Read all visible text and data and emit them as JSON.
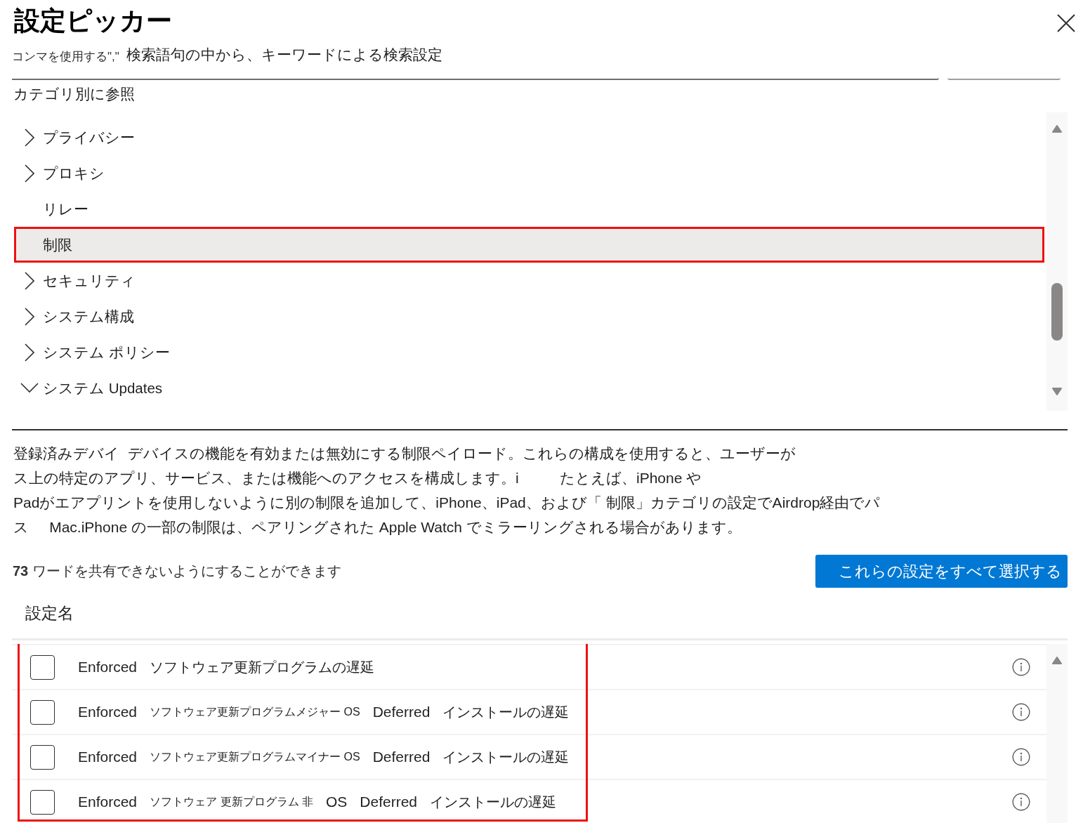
{
  "window": {
    "title": "設定ピッカー"
  },
  "search": {
    "hint": "コンマを使用する\",\"",
    "placeholder": "検索語句の中から、キーワードによる検索設定"
  },
  "browse_label": "カテゴリ別に参照",
  "tree": {
    "items": [
      {
        "label": "プライバシー",
        "kind": "group",
        "expanded": false,
        "selected": false,
        "highlighted": false
      },
      {
        "label": "プロキシ",
        "kind": "group",
        "expanded": false,
        "selected": false,
        "highlighted": false
      },
      {
        "label": "リレー",
        "kind": "leaf",
        "selected": false,
        "highlighted": false
      },
      {
        "label": "制限",
        "kind": "leaf",
        "selected": true,
        "highlighted": true
      },
      {
        "label": "セキュリティ",
        "kind": "group",
        "expanded": false,
        "selected": false,
        "highlighted": false
      },
      {
        "label": "システム構成",
        "kind": "group",
        "expanded": false,
        "selected": false,
        "highlighted": false
      },
      {
        "label": "システム ポリシー",
        "kind": "group",
        "expanded": false,
        "selected": false,
        "highlighted": false
      },
      {
        "label": "システム Updates",
        "kind": "group",
        "expanded": true,
        "selected": false,
        "highlighted": false
      }
    ]
  },
  "description_lines": [
    "登録済みデバイ  デバイスの機能を有効または無効にする制限ペイロード。これらの構成を使用すると、ユーザーが",
    "ス上の特定のアプリ、サービス、または機能へのアクセスを構成します。i          たとえば、iPhone や",
    "Padがエアプリントを使用しないように別の制限を追加して、iPhone、iPad、および「 制限」カテゴリの設定でAirdrop経由でパ",
    "ス     Mac.iPhone の一部の制限は、ペアリングされた Apple Watch でミラーリングされる場合があります。"
  ],
  "count_text": "**73** ワードを共有できないようにすることができます",
  "select_all_button": "これらの設定をすべて選択する",
  "table": {
    "columns": [
      "設定名"
    ],
    "highlighted": true,
    "rows": [
      {
        "checked": false,
        "name_parts": [
          {
            "kind": "medium",
            "text": "Enforced"
          },
          {
            "kind": "large",
            "text": "ソフトウェア更新プログラムの遅延"
          }
        ]
      },
      {
        "checked": false,
        "name_parts": [
          {
            "kind": "medium",
            "text": "Enforced"
          },
          {
            "kind": "small",
            "text": "ソフトウェア更新プログラムメジャー OS"
          },
          {
            "kind": "medium",
            "text": "Deferred"
          },
          {
            "kind": "large",
            "text": "インストールの遅延"
          }
        ]
      },
      {
        "checked": false,
        "name_parts": [
          {
            "kind": "medium",
            "text": "Enforced"
          },
          {
            "kind": "small",
            "text": "ソフトウェア更新プログラムマイナー OS"
          },
          {
            "kind": "medium",
            "text": "Deferred"
          },
          {
            "kind": "large",
            "text": "インストールの遅延"
          }
        ]
      },
      {
        "checked": false,
        "name_parts": [
          {
            "kind": "medium",
            "text": "Enforced"
          },
          {
            "kind": "small",
            "text": "ソフトウェア 更新プログラム 非"
          },
          {
            "kind": "medium",
            "text": "OS"
          },
          {
            "kind": "medium",
            "text": "Deferred"
          },
          {
            "kind": "large",
            "text": "インストールの遅延"
          }
        ]
      }
    ]
  }
}
